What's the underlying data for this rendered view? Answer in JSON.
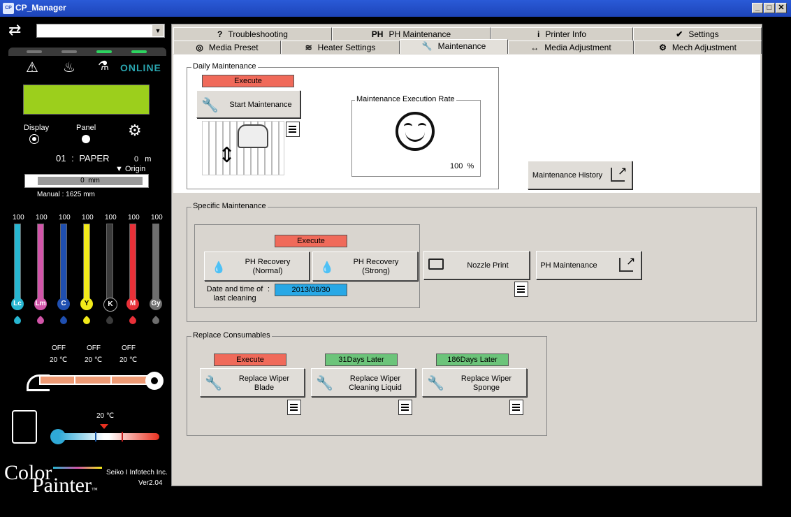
{
  "window": {
    "title": "CP_Manager",
    "app_icon": "CP"
  },
  "left": {
    "status_online": "ONLINE",
    "display_label": "Display",
    "panel_label": "Panel",
    "media_slot": "01",
    "media_name": "PAPER",
    "media_length": "0",
    "media_length_unit": "m",
    "origin_label": "Origin",
    "origin_value": "0",
    "origin_unit": "mm",
    "manual_label": "Manual",
    "manual_value": "1625",
    "manual_unit": "mm",
    "inks": [
      {
        "code": "Lc",
        "level": "100",
        "color": "#27b6d1"
      },
      {
        "code": "Lm",
        "level": "100",
        "color": "#d255a9"
      },
      {
        "code": "C",
        "level": "100",
        "color": "#1f4fb0"
      },
      {
        "code": "Y",
        "level": "100",
        "color": "#f2ea1a"
      },
      {
        "code": "K",
        "level": "100",
        "color": "#3b3b3b"
      },
      {
        "code": "M",
        "level": "100",
        "color": "#e83038"
      },
      {
        "code": "Gy",
        "level": "100",
        "color": "#6e6e6e"
      }
    ],
    "heaters": [
      {
        "state": "OFF",
        "temp": "20 ℃"
      },
      {
        "state": "OFF",
        "temp": "20 ℃"
      },
      {
        "state": "OFF",
        "temp": "20 ℃"
      }
    ],
    "ambient_temp": "20 ℃",
    "brand_line1": "Color",
    "brand_line2": "Painter",
    "brand_tm": "™",
    "company": "Seiko I Infotech Inc.",
    "version": "Ver2.04"
  },
  "tabs_row1": [
    {
      "icon": "?",
      "label": "Troubleshooting"
    },
    {
      "icon": "PH",
      "label": "PH Maintenance"
    },
    {
      "icon": "i",
      "label": "Printer Info"
    },
    {
      "icon": "✔",
      "label": "Settings"
    }
  ],
  "tabs_row2": [
    {
      "icon": "◎",
      "label": "Media Preset"
    },
    {
      "icon": "≋",
      "label": "Heater Settings"
    },
    {
      "icon": "🔧",
      "label": "Maintenance"
    },
    {
      "icon": "↔",
      "label": "Media Adjustment"
    },
    {
      "icon": "⚙",
      "label": "Mech Adjustment"
    }
  ],
  "daily": {
    "legend": "Daily Maintenance",
    "status": "Execute",
    "start_button": "Start Maintenance",
    "rate_label": "Maintenance Execution Rate",
    "rate_value": "100",
    "rate_unit": "%"
  },
  "history_button": "Maintenance History",
  "specific": {
    "legend": "Specific Maintenance",
    "status": "Execute",
    "ph_recovery_normal": [
      "PH Recovery",
      "(Normal)"
    ],
    "ph_recovery_strong": [
      "PH Recovery",
      "(Strong)"
    ],
    "last_cleaning_label": [
      "Date and time of",
      "last cleaning"
    ],
    "last_cleaning_colon": ":",
    "last_cleaning_value": "2013/08/30",
    "nozzle_print": "Nozzle Print",
    "ph_maintenance": "PH Maintenance"
  },
  "consumables": {
    "legend": "Replace Consumables",
    "items": [
      {
        "status": "Execute",
        "status_type": "execute",
        "label": [
          "Replace Wiper",
          "Blade"
        ]
      },
      {
        "status": "31Days Later",
        "status_type": "later",
        "label": [
          "Replace Wiper",
          "Cleaning Liquid"
        ]
      },
      {
        "status": "186Days Later",
        "status_type": "later",
        "label": [
          "Replace Wiper",
          "Sponge"
        ]
      }
    ]
  }
}
